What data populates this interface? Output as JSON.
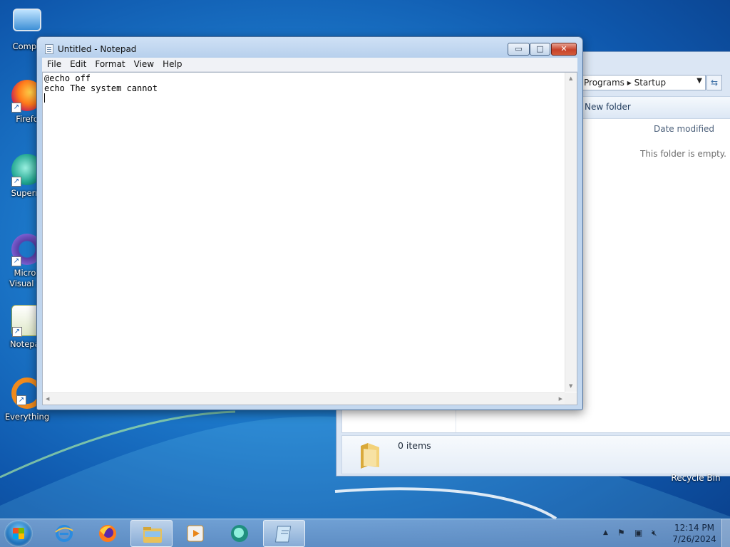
{
  "desktop": {
    "icons": [
      {
        "label": "Compu",
        "icon": "computer-icon"
      },
      {
        "label": "Firefo",
        "icon": "firefox-icon"
      },
      {
        "label": "Superm",
        "icon": "supermium-icon"
      },
      {
        "label": "Micros",
        "label2": "Visual St",
        "icon": "visual-studio-icon"
      },
      {
        "label": "Notepac",
        "icon": "notepadpp-icon"
      },
      {
        "label": "Everything",
        "icon": "everything-icon"
      }
    ],
    "recycle_bin": "Recycle Bin"
  },
  "explorer": {
    "address": {
      "segment1": "Programs",
      "separator": "▸",
      "segment2": "Startup"
    },
    "toolbar": {
      "new_folder": "New folder"
    },
    "column_header": "Date modified",
    "empty_message": "This folder is empty.",
    "status": "0 items"
  },
  "notepad": {
    "title": "Untitled - Notepad",
    "menu": [
      "File",
      "Edit",
      "Format",
      "View",
      "Help"
    ],
    "lines": [
      "@echo off",
      "echo The system cannot"
    ],
    "buttons": {
      "minimize": "▭",
      "maximize": "□",
      "close": "✕"
    }
  },
  "taskbar": {
    "pinned": [
      "internet-explorer-icon",
      "firefox-icon",
      "file-explorer-icon",
      "media-player-icon",
      "supermium-icon",
      "notepad-icon"
    ],
    "clock": {
      "time": "12:14 PM",
      "date": "7/26/2024"
    }
  },
  "colors": {
    "accent": "#1f7fd0",
    "close": "#c7432b"
  }
}
